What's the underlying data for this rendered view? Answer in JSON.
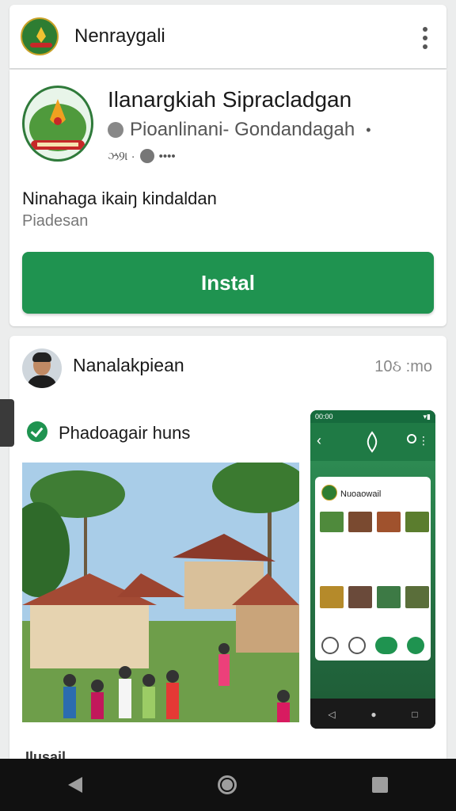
{
  "header": {
    "title": "Nenraygali"
  },
  "app": {
    "name": "Ilanargkiah Sipracladgan",
    "developer": "Pioanlinani- Gondandagah",
    "developer_suffix": "•",
    "meta_left": "ઝ9ા ·",
    "meta_right": "••••",
    "description": "Ninahaga ikaiŋ kindaldan",
    "subtext": "Piadesan",
    "install_label": "Instal"
  },
  "post": {
    "author": "Nanalakpiean",
    "time": "10ઠ :mo",
    "tag": "Phadoagair huns",
    "phone_screen": {
      "status_time": "00:00",
      "card_title": "Nuoaowail"
    },
    "footer_peek": "Ilusail"
  },
  "colors": {
    "accent": "#1f9350",
    "app_bar": "#1f7a45",
    "background": "#eceded"
  },
  "icons": {
    "more": "more-vertical-icon",
    "location": "location-pin-icon",
    "globe": "globe-icon",
    "verified": "check-circle-icon",
    "nav_back": "triangle-back-icon",
    "nav_home": "circle-home-icon",
    "nav_recent": "square-recents-icon"
  }
}
